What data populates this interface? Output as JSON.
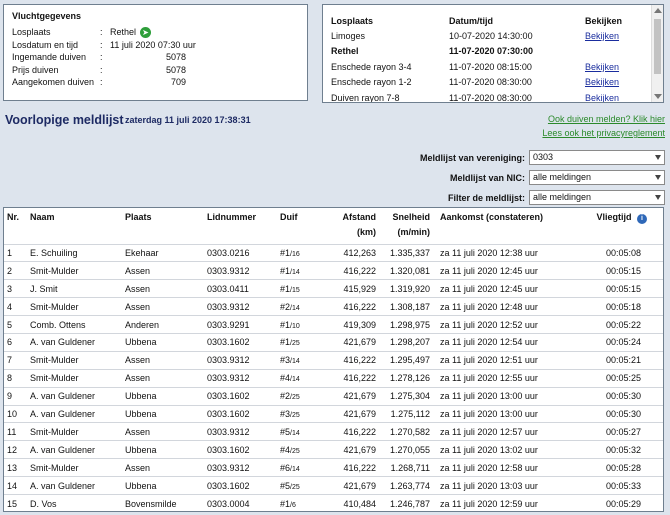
{
  "flight": {
    "title": "Vluchtgegevens",
    "rows": [
      {
        "label": "Losplaats",
        "value": "Rethel"
      },
      {
        "label": "Losdatum en tijd",
        "value": "11 juli 2020 07:30 uur"
      },
      {
        "label": "Ingemande duiven",
        "value": "5078"
      },
      {
        "label": "Prijs duiven",
        "value": "5078"
      },
      {
        "label": "Aangekomen duiven",
        "value": "709"
      }
    ]
  },
  "losplaats": {
    "headers": [
      "Losplaats",
      "Datum/tijd",
      "Bekijken"
    ],
    "rows": [
      {
        "place": "Limoges",
        "datetime": "10-07-2020 14:30:00",
        "link": "Bekijken"
      },
      {
        "place": "Rethel",
        "datetime": "11-07-2020 07:30:00",
        "link": ""
      },
      {
        "place": "Enschede rayon 3-4",
        "datetime": "11-07-2020 08:15:00",
        "link": "Bekijken"
      },
      {
        "place": "Enschede rayon 1-2",
        "datetime": "11-07-2020 08:30:00",
        "link": "Bekijken"
      },
      {
        "place": "Duiven rayon 7-8",
        "datetime": "11-07-2020 08:30:00",
        "link": "Bekijken"
      }
    ]
  },
  "page": {
    "title": "Voorlopige meldlijst",
    "datetime": "zaterdag 11 juli 2020 17:38:31",
    "link1": "Ook duiven melden? Klik hier",
    "link2": "Lees ook het privacyreglement"
  },
  "filters": {
    "vereniging_label": "Meldlijst van vereniging:",
    "vereniging_value": "0303",
    "nic_label": "Meldlijst van NIC:",
    "nic_value": "alle meldingen",
    "filter_label": "Filter de meldlijst:",
    "filter_value": "alle meldingen"
  },
  "table": {
    "headers": {
      "nr": "Nr.",
      "naam": "Naam",
      "plaats": "Plaats",
      "lid": "Lidnummer",
      "duif": "Duif",
      "afstand": "Afstand",
      "afstand_unit": "(km)",
      "snelheid": "Snelheid",
      "snelheid_unit": "(m/min)",
      "aankomst": "Aankomst (constateren)",
      "vliegtijd": "Vliegtijd"
    },
    "rows": [
      {
        "nr": "1",
        "naam": "E. Schuiling",
        "plaats": "Ekehaar",
        "lid": "0303.0216",
        "duif_n": "#1",
        "duif_s": "/16",
        "afstand": "412,263",
        "snelheid": "1.335,337",
        "aankomst": "za 11 juli 2020 12:38 uur",
        "vliegtijd": "00:05:08"
      },
      {
        "nr": "2",
        "naam": "Smit-Mulder",
        "plaats": "Assen",
        "lid": "0303.9312",
        "duif_n": "#1",
        "duif_s": "/14",
        "afstand": "416,222",
        "snelheid": "1.320,081",
        "aankomst": "za 11 juli 2020 12:45 uur",
        "vliegtijd": "00:05:15"
      },
      {
        "nr": "3",
        "naam": "J. Smit",
        "plaats": "Assen",
        "lid": "0303.0411",
        "duif_n": "#1",
        "duif_s": "/15",
        "afstand": "415,929",
        "snelheid": "1.319,920",
        "aankomst": "za 11 juli 2020 12:45 uur",
        "vliegtijd": "00:05:15"
      },
      {
        "nr": "4",
        "naam": "Smit-Mulder",
        "plaats": "Assen",
        "lid": "0303.9312",
        "duif_n": "#2",
        "duif_s": "/14",
        "afstand": "416,222",
        "snelheid": "1.308,187",
        "aankomst": "za 11 juli 2020 12:48 uur",
        "vliegtijd": "00:05:18"
      },
      {
        "nr": "5",
        "naam": "Comb. Ottens",
        "plaats": "Anderen",
        "lid": "0303.9291",
        "duif_n": "#1",
        "duif_s": "/10",
        "afstand": "419,309",
        "snelheid": "1.298,975",
        "aankomst": "za 11 juli 2020 12:52 uur",
        "vliegtijd": "00:05:22"
      },
      {
        "nr": "6",
        "naam": "A. van Guldener",
        "plaats": "Ubbena",
        "lid": "0303.1602",
        "duif_n": "#1",
        "duif_s": "/25",
        "afstand": "421,679",
        "snelheid": "1.298,207",
        "aankomst": "za 11 juli 2020 12:54 uur",
        "vliegtijd": "00:05:24"
      },
      {
        "nr": "7",
        "naam": "Smit-Mulder",
        "plaats": "Assen",
        "lid": "0303.9312",
        "duif_n": "#3",
        "duif_s": "/14",
        "afstand": "416,222",
        "snelheid": "1.295,497",
        "aankomst": "za 11 juli 2020 12:51 uur",
        "vliegtijd": "00:05:21"
      },
      {
        "nr": "8",
        "naam": "Smit-Mulder",
        "plaats": "Assen",
        "lid": "0303.9312",
        "duif_n": "#4",
        "duif_s": "/14",
        "afstand": "416,222",
        "snelheid": "1.278,126",
        "aankomst": "za 11 juli 2020 12:55 uur",
        "vliegtijd": "00:05:25"
      },
      {
        "nr": "9",
        "naam": "A. van Guldener",
        "plaats": "Ubbena",
        "lid": "0303.1602",
        "duif_n": "#2",
        "duif_s": "/25",
        "afstand": "421,679",
        "snelheid": "1.275,304",
        "aankomst": "za 11 juli 2020 13:00 uur",
        "vliegtijd": "00:05:30"
      },
      {
        "nr": "10",
        "naam": "A. van Guldener",
        "plaats": "Ubbena",
        "lid": "0303.1602",
        "duif_n": "#3",
        "duif_s": "/25",
        "afstand": "421,679",
        "snelheid": "1.275,112",
        "aankomst": "za 11 juli 2020 13:00 uur",
        "vliegtijd": "00:05:30"
      },
      {
        "nr": "11",
        "naam": "Smit-Mulder",
        "plaats": "Assen",
        "lid": "0303.9312",
        "duif_n": "#5",
        "duif_s": "/14",
        "afstand": "416,222",
        "snelheid": "1.270,582",
        "aankomst": "za 11 juli 2020 12:57 uur",
        "vliegtijd": "00:05:27"
      },
      {
        "nr": "12",
        "naam": "A. van Guldener",
        "plaats": "Ubbena",
        "lid": "0303.1602",
        "duif_n": "#4",
        "duif_s": "/25",
        "afstand": "421,679",
        "snelheid": "1.270,055",
        "aankomst": "za 11 juli 2020 13:02 uur",
        "vliegtijd": "00:05:32"
      },
      {
        "nr": "13",
        "naam": "Smit-Mulder",
        "plaats": "Assen",
        "lid": "0303.9312",
        "duif_n": "#6",
        "duif_s": "/14",
        "afstand": "416,222",
        "snelheid": "1.268,711",
        "aankomst": "za 11 juli 2020 12:58 uur",
        "vliegtijd": "00:05:28"
      },
      {
        "nr": "14",
        "naam": "A. van Guldener",
        "plaats": "Ubbena",
        "lid": "0303.1602",
        "duif_n": "#5",
        "duif_s": "/25",
        "afstand": "421,679",
        "snelheid": "1.263,774",
        "aankomst": "za 11 juli 2020 13:03 uur",
        "vliegtijd": "00:05:33"
      },
      {
        "nr": "15",
        "naam": "D. Vos",
        "plaats": "Bovensmilde",
        "lid": "0303.0004",
        "duif_n": "#1",
        "duif_s": "/6",
        "afstand": "410,484",
        "snelheid": "1.246,787",
        "aankomst": "za 11 juli 2020 12:59 uur",
        "vliegtijd": "00:05:29"
      }
    ]
  }
}
